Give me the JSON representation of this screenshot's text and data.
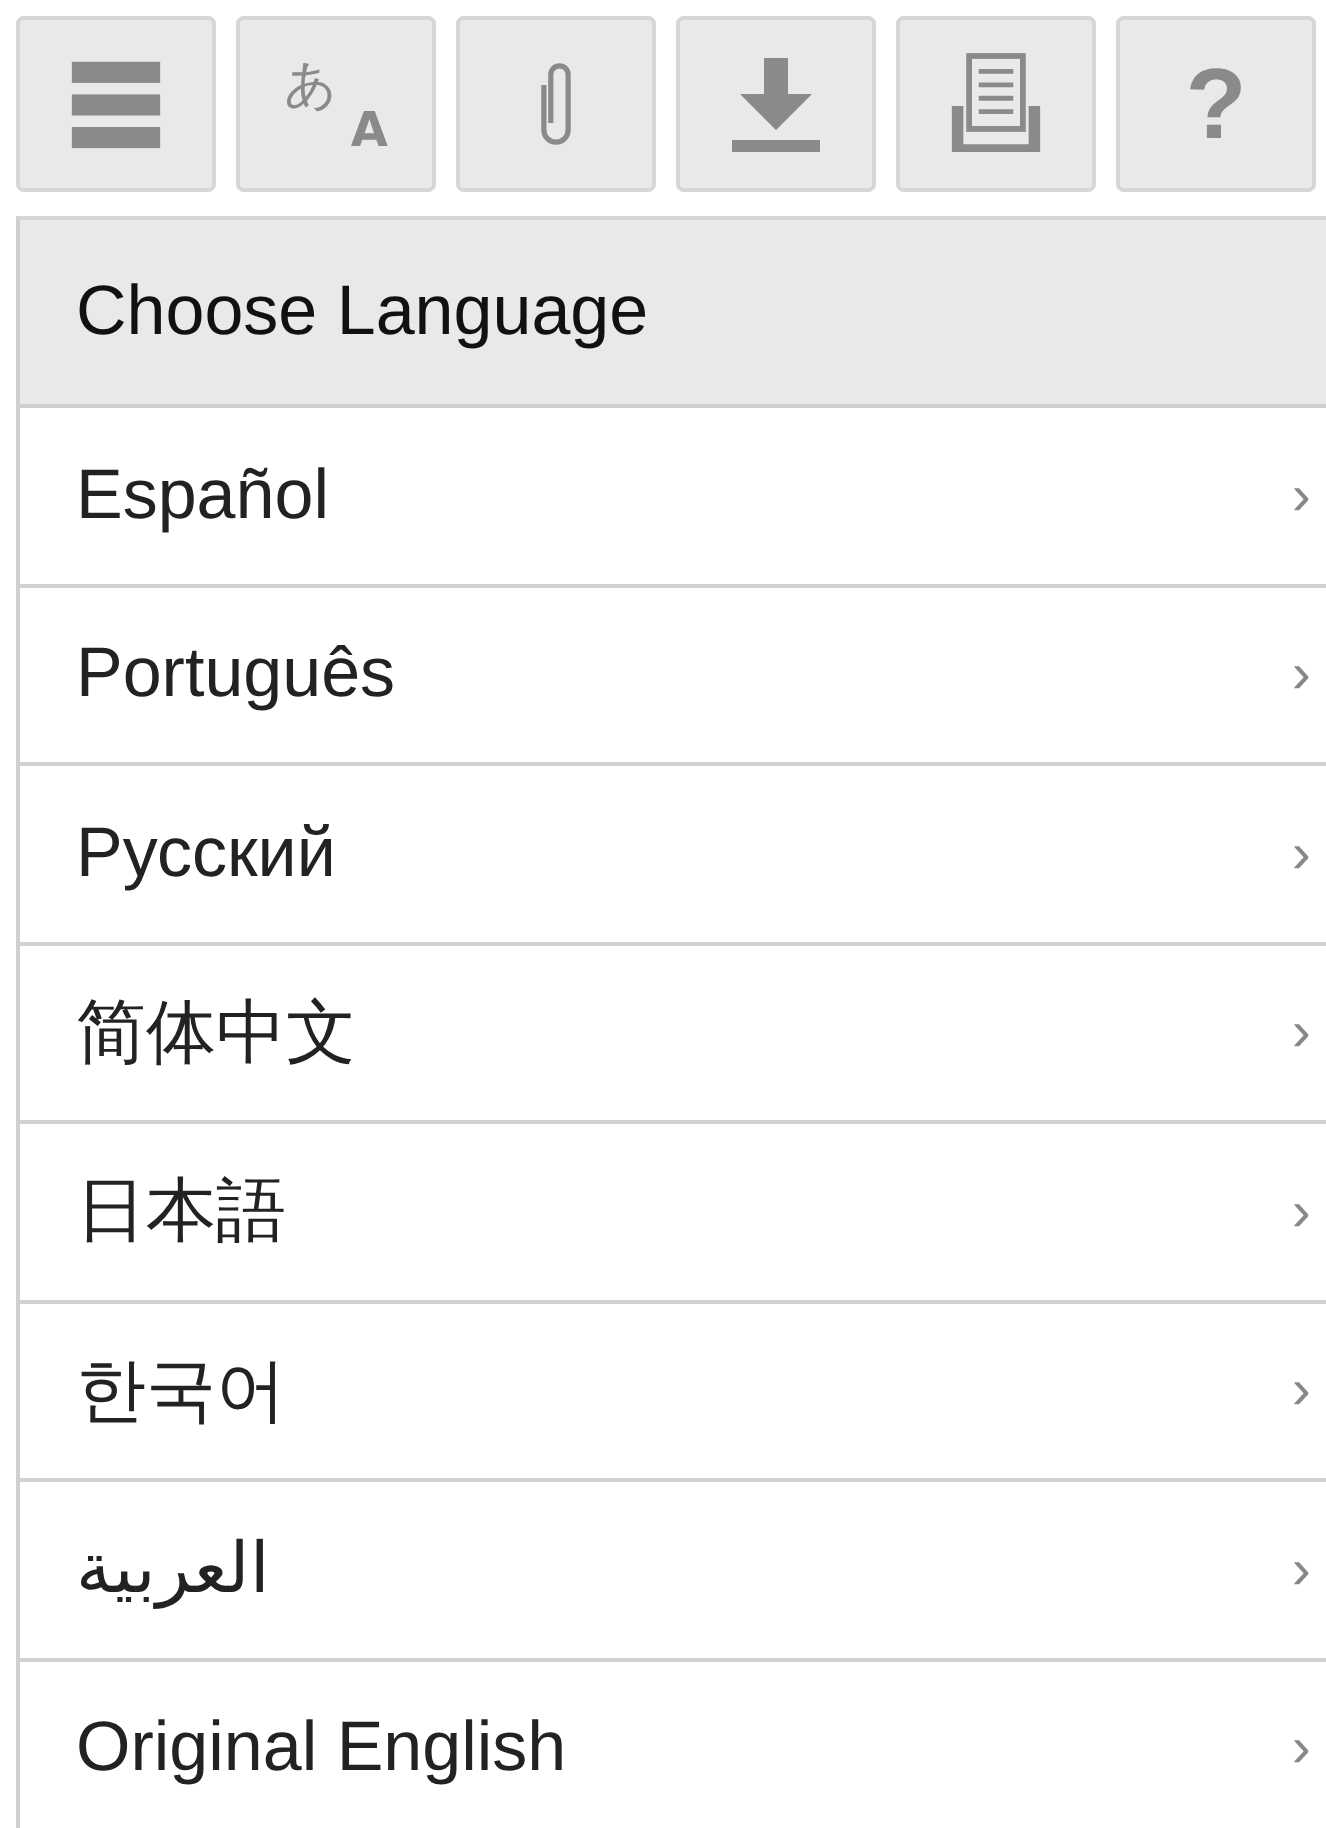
{
  "toolbar": [
    {
      "kind": "menu"
    },
    {
      "kind": "translate",
      "glyph": "あ",
      "sub": "A"
    },
    {
      "kind": "attach"
    },
    {
      "kind": "download"
    },
    {
      "kind": "print"
    },
    {
      "kind": "help",
      "glyph": "?"
    }
  ],
  "panel": {
    "title": "Choose Language",
    "items": [
      {
        "label": "Español",
        "chevron": "›"
      },
      {
        "label": "Português",
        "chevron": "›"
      },
      {
        "label": "Русский",
        "chevron": "›"
      },
      {
        "label": "简体中文",
        "chevron": "›"
      },
      {
        "label": "日本語",
        "chevron": "›"
      },
      {
        "label": "한국어",
        "chevron": "›"
      },
      {
        "label": "العربية",
        "chevron": "›"
      },
      {
        "label": "Original English",
        "chevron": "›"
      }
    ]
  }
}
